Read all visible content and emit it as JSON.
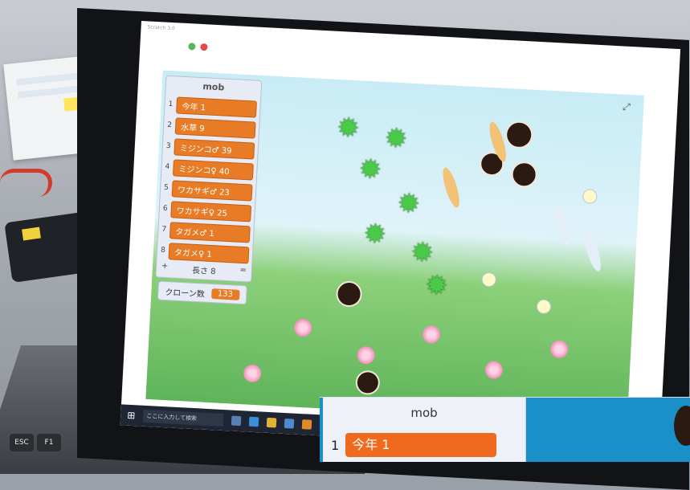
{
  "window": {
    "title": "Scratch 3.0"
  },
  "list_monitor": {
    "title": "mob",
    "items": [
      {
        "index": "1",
        "label": "今年 1"
      },
      {
        "index": "2",
        "label": "水草 9"
      },
      {
        "index": "3",
        "label": "ミジンコ♂ 39"
      },
      {
        "index": "4",
        "label": "ミジンコ♀ 40"
      },
      {
        "index": "5",
        "label": "ワカサギ♂ 23"
      },
      {
        "index": "6",
        "label": "ワカサギ♀ 25"
      },
      {
        "index": "7",
        "label": "タガメ♂ 1"
      },
      {
        "index": "8",
        "label": "タガメ♀ 1"
      }
    ],
    "footer_add": "+",
    "footer_length": "長さ 8",
    "footer_resize": "="
  },
  "variable_monitor": {
    "label": "クローン数",
    "value": "133"
  },
  "taskbar": {
    "search_placeholder": "ここに入力して検索"
  },
  "inset": {
    "title": "mob",
    "row_index": "1",
    "row_label": "今年 1"
  },
  "keyboard": {
    "esc": "ESC",
    "f1": "F1"
  },
  "colors": {
    "list_item": "#e87b25",
    "stage_sky": "#c8ecf6",
    "inset_bg": "#1a8fc8"
  }
}
